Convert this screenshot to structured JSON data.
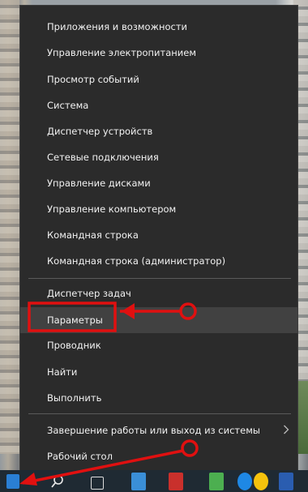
{
  "menu": {
    "items": [
      {
        "label": "Приложения и возможности"
      },
      {
        "label": "Управление электропитанием"
      },
      {
        "label": "Просмотр событий"
      },
      {
        "label": "Система"
      },
      {
        "label": "Диспетчер устройств"
      },
      {
        "label": "Сетевые подключения"
      },
      {
        "label": "Управление дисками"
      },
      {
        "label": "Управление компьютером"
      },
      {
        "label": "Командная строка"
      },
      {
        "label": "Командная строка (администратор)"
      }
    ],
    "items2": [
      {
        "label": "Диспетчер задач"
      },
      {
        "label": "Параметры"
      },
      {
        "label": "Проводник"
      },
      {
        "label": "Найти"
      },
      {
        "label": "Выполнить"
      }
    ],
    "items3": [
      {
        "label": "Завершение работы или выход из системы",
        "submenu_icon": "chevron-right-icon"
      },
      {
        "label": "Рабочий стол"
      }
    ],
    "highlighted_item": "Параметры"
  },
  "colors": {
    "menu_bg": "#2b2b2b",
    "menu_text": "#f2f2f2",
    "hover_bg": "#414141",
    "annotation_red": "#e01010",
    "taskbar_bg": "#1f2a33"
  },
  "taskbar": {
    "icons": [
      "start-icon",
      "search-icon",
      "task-view-icon",
      "store-icon",
      "app-icon",
      "phone-icon",
      "ie-icon",
      "chrome-icon",
      "app2-icon"
    ]
  }
}
